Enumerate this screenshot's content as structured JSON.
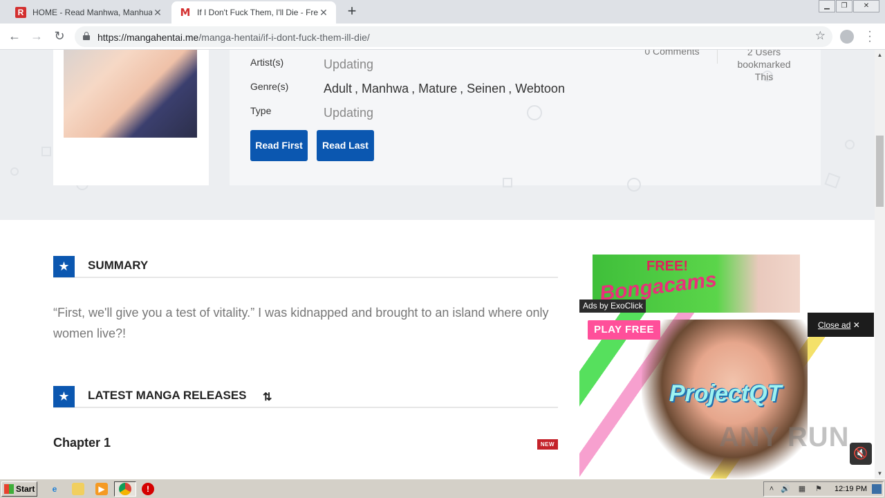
{
  "browser": {
    "tabs": [
      {
        "title": "HOME - Read Manhwa, Manhua, We",
        "favicon": "R"
      },
      {
        "title": "If I Don't Fuck Them, I'll Die - Free H",
        "favicon": "M"
      }
    ],
    "new_tab": "+",
    "url_domain": "https://mangahentai.me",
    "url_path": "/manga-hentai/if-i-dont-fuck-them-ill-die/"
  },
  "manga": {
    "comments_partial": "0 Comments",
    "bookmarks_partial": "2 Users",
    "bookmarked_line1": "bookmarked",
    "bookmarked_line2": "This",
    "artist_label": "Artist(s)",
    "artist_value": "Updating",
    "genre_label": "Genre(s)",
    "genres": [
      "Adult",
      "Manhwa",
      "Mature",
      "Seinen",
      "Webtoon"
    ],
    "type_label": "Type",
    "type_value": "Updating",
    "read_first": "Read First",
    "read_last": "Read Last"
  },
  "summary": {
    "heading": "SUMMARY",
    "text": "“First, we'll give you a test of vitality.” I was kidnapped and brought to an island where only women live?!"
  },
  "releases": {
    "heading": "LATEST MANGA RELEASES",
    "chapter": "Chapter 1",
    "badge": "NEW"
  },
  "side_ad": {
    "free": "FREE!",
    "brand": "Bongacams"
  },
  "overlay_ad": {
    "ads_by": "Ads by ExoClick",
    "close": "Close ad",
    "play_free": "PLAY FREE",
    "logo": "ProjectQT",
    "watermark": "ANY RUN"
  },
  "taskbar": {
    "start": "Start",
    "clock": "12:19 PM"
  },
  "colors": {
    "accent": "#0b57b0",
    "new_badge": "#c4222a",
    "hero_bg": "#eceef1"
  }
}
